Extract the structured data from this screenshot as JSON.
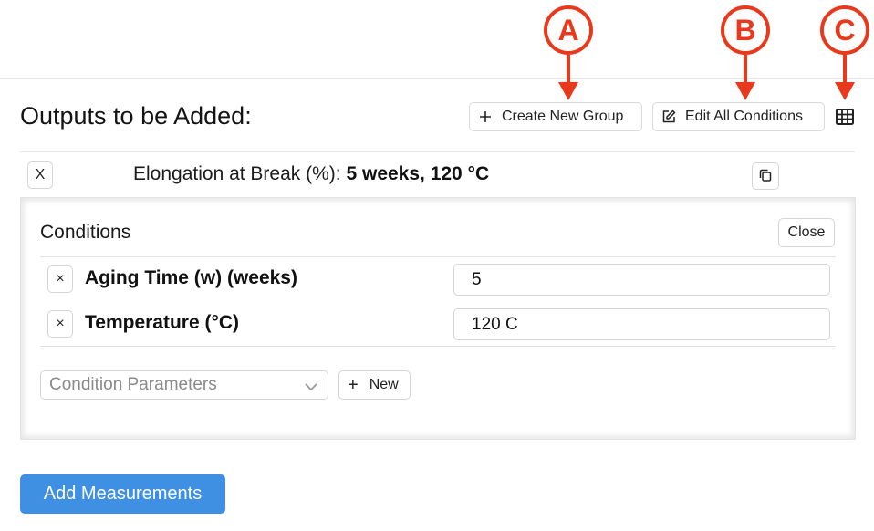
{
  "annotations": {
    "a": "A",
    "b": "B",
    "c": "C",
    "color": "#e8391d"
  },
  "header": {
    "title": "Outputs to be Added:",
    "create_group_label": "Create New Group",
    "edit_conditions_label": "Edit All Conditions",
    "icons": [
      "plus-icon",
      "edit-icon",
      "table-icon"
    ]
  },
  "output": {
    "remove_label": "X",
    "property": "Elongation at Break (%):",
    "conditions_summary": "5 weeks, 120 °C",
    "icons": [
      "copy-icon"
    ]
  },
  "conditions_panel": {
    "title": "Conditions",
    "close_label": "Close",
    "rows": [
      {
        "remove_label": "×",
        "label": "Aging Time (w) (weeks)",
        "value": "5"
      },
      {
        "remove_label": "×",
        "label": "Temperature (°C)",
        "value": "120 C"
      }
    ],
    "select_placeholder": "Condition Parameters",
    "new_plus": "+",
    "new_label": "New"
  },
  "footer": {
    "add_measurements_label": "Add Measurements"
  },
  "colors": {
    "primary": "#3f8fe3",
    "annotation": "#e8391d",
    "border": "#d5d5d5"
  }
}
